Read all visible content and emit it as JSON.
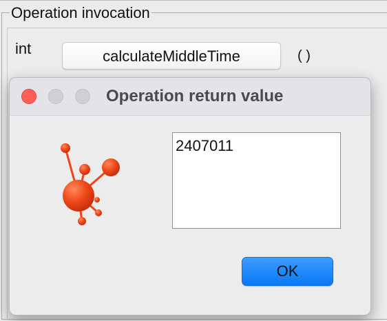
{
  "invocation": {
    "legend": "Operation invocation",
    "return_type": "int",
    "method_name": "calculateMiddleTime",
    "params": "( )"
  },
  "dialog": {
    "title": "Operation return value",
    "result_value": "2407011",
    "ok_label": "OK",
    "logo_icon": "molecule-logo-icon",
    "colors": {
      "close": "#fe5f57",
      "ok_button": "#1a86f8",
      "logo": "#ee4518"
    }
  }
}
